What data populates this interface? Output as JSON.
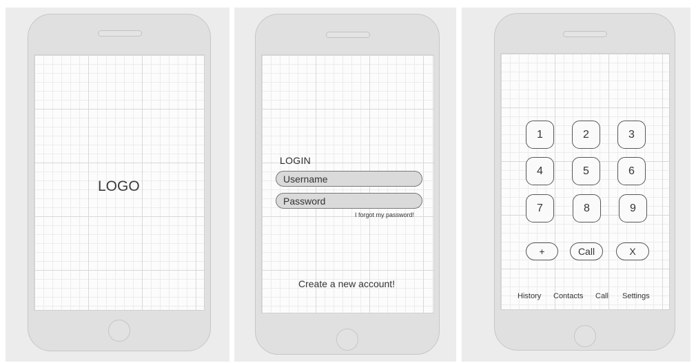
{
  "splash_screen": {
    "logo_text": "LOGO"
  },
  "login_screen": {
    "title": "LOGIN",
    "username_placeholder": "Username",
    "password_placeholder": "Password",
    "forgot_link": "I forgot my password!",
    "create_account_link": "Create a new account!"
  },
  "dialer_screen": {
    "keys": [
      "1",
      "2",
      "3",
      "4",
      "5",
      "6",
      "7",
      "8",
      "9"
    ],
    "actions": {
      "add": "+",
      "call": "Call",
      "clear": "X"
    },
    "nav": [
      "History",
      "Contacts",
      "Call",
      "Settings"
    ]
  }
}
